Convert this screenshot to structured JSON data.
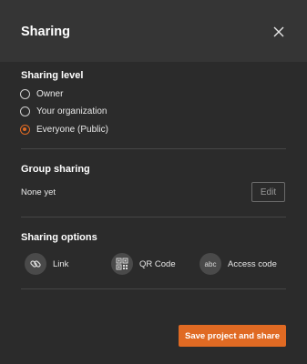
{
  "dialog": {
    "title": "Sharing",
    "close_icon": "close-icon"
  },
  "sharing_level": {
    "heading": "Sharing level",
    "options": [
      {
        "label": "Owner",
        "selected": false
      },
      {
        "label": "Your organization",
        "selected": false
      },
      {
        "label": "Everyone (Public)",
        "selected": true
      }
    ]
  },
  "group_sharing": {
    "heading": "Group sharing",
    "status": "None yet",
    "edit_label": "Edit"
  },
  "sharing_options": {
    "heading": "Sharing options",
    "items": [
      {
        "label": "Link",
        "icon": "link-icon"
      },
      {
        "label": "QR Code",
        "icon": "qr-code-icon"
      },
      {
        "label": "Access code",
        "icon": "abc-icon",
        "icon_text": "abc"
      }
    ]
  },
  "footer": {
    "save_label": "Save project and share"
  },
  "colors": {
    "accent": "#e06a23",
    "background": "#2b2b2b",
    "header": "#353535"
  }
}
